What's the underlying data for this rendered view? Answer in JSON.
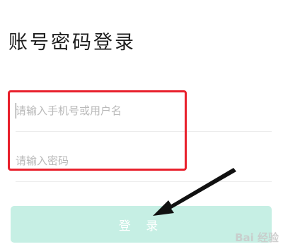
{
  "page_title": "账号密码登录",
  "form": {
    "username_placeholder": "请输入手机号或用户名",
    "username_value": "",
    "password_placeholder": "请输入密码",
    "password_value": ""
  },
  "login_button": {
    "label": "登 录",
    "background_color": "#c6efe4"
  },
  "annotation": {
    "highlight_color": "#e8202c",
    "arrow_color": "#000000"
  },
  "watermark": {
    "text": "Bai 经验",
    "icon": "baidu-paw-icon"
  }
}
